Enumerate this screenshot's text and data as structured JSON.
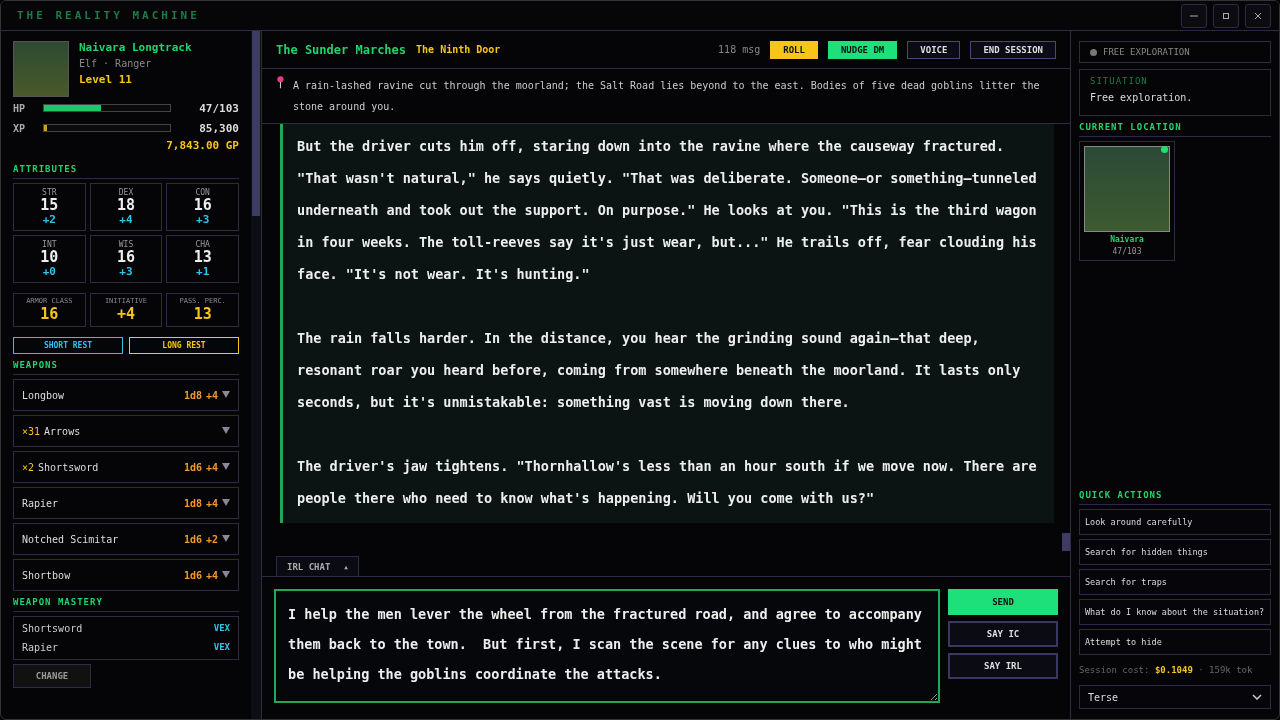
{
  "window": {
    "title": "THE REALITY MACHINE"
  },
  "character": {
    "name": "Naivara Longtrack",
    "race_class": "Elf · Ranger",
    "level": "Level 11",
    "hp": {
      "label": "HP",
      "level": 0.456,
      "reading": "47/103"
    },
    "xp": {
      "label": "XP",
      "level": 0.02,
      "reading": "85,300"
    },
    "gold": "7,843.00 GP"
  },
  "attributes_title": "ATTRIBUTES",
  "attributes": [
    {
      "abbr": "STR",
      "score": "15",
      "mod": "+2"
    },
    {
      "abbr": "DEX",
      "score": "18",
      "mod": "+4"
    },
    {
      "abbr": "CON",
      "score": "16",
      "mod": "+3"
    },
    {
      "abbr": "INT",
      "score": "10",
      "mod": "+0"
    },
    {
      "abbr": "WIS",
      "score": "16",
      "mod": "+3"
    },
    {
      "abbr": "CHA",
      "score": "13",
      "mod": "+1"
    }
  ],
  "derived": [
    {
      "label": "ARMOR CLASS",
      "value": "16"
    },
    {
      "label": "INITIATIVE",
      "value": "+4"
    },
    {
      "label": "PASS. PERC.",
      "value": "13"
    }
  ],
  "rest_buttons": [
    {
      "label": "SHORT REST",
      "kind": "short"
    },
    {
      "label": "LONG REST",
      "kind": "long"
    }
  ],
  "weapons_title": "WEAPONS",
  "weapons": [
    {
      "name": "Longbow",
      "damage": "1d8",
      "bonus": "+4"
    },
    {
      "qty": "×31",
      "name": "Arrows"
    },
    {
      "qty": "×2",
      "name": "Shortsword",
      "damage": "1d6",
      "bonus": "+4"
    },
    {
      "name": "Rapier",
      "damage": "1d8",
      "bonus": "+4"
    },
    {
      "name": "Notched Scimitar",
      "damage": "1d6",
      "bonus": "+2"
    },
    {
      "name": "Shortbow",
      "damage": "1d6",
      "bonus": "+4"
    }
  ],
  "mastery_title": "WEAPON MASTERY",
  "mastery": [
    {
      "name": "Shortsword",
      "property": "VEX"
    },
    {
      "name": "Rapier",
      "property": "VEX"
    }
  ],
  "change_button": "CHANGE",
  "header": {
    "campaign": "The Sunder Marches",
    "chapter": "The Ninth Door",
    "msg_count": "118 msg",
    "buttons": [
      {
        "label": "ROLL",
        "kind": "yellow"
      },
      {
        "label": "NUDGE DM",
        "kind": "green"
      },
      {
        "label": "VOICE",
        "kind": "outline"
      },
      {
        "label": "END SESSION",
        "kind": "outline"
      }
    ]
  },
  "location_text": "A rain-lashed ravine cut through the moorland; the Salt Road lies beyond to the east. Bodies of five dead goblins litter the stone around you.",
  "narrative": [
    "But the driver cuts him off, staring down into the ravine where the causeway fractured. \"That wasn't natural,\" he says quietly. \"That was deliberate. Someone—or something—tunneled underneath and took out the support. On purpose.\" He looks at you. \"This is the third wagon in four weeks. The toll-reeves say it's just wear, but...\" He trails off, fear clouding his face. \"It's not wear. It's hunting.\"",
    "The rain falls harder. In the distance, you hear the grinding sound again—that deep, resonant roar you heard before, coming from somewhere beneath the moorland. It lasts only seconds, but it's unmistakable: something vast is moving down there.",
    "The driver's jaw tightens. \"Thornhallow's less than an hour south if we move now. There are people there who need to know what's happening. Will you come with us?\""
  ],
  "chat_tab": {
    "label": "IRL CHAT",
    "caret": "▲"
  },
  "input": {
    "value": "I help the men lever the wheel from the fractured road, and agree to accompany them back to the town.  But first, I scan the scene for any clues to who might be helping the goblins coordinate the attacks."
  },
  "send_buttons": [
    {
      "label": "SEND",
      "kind": "primary"
    },
    {
      "label": "SAY IC",
      "kind": "outline"
    },
    {
      "label": "SAY IRL",
      "kind": "outline"
    }
  ],
  "mode": {
    "label": "FREE EXPLORATION"
  },
  "situation": {
    "title": "SITUATION",
    "text": "Free exploration."
  },
  "location_title": "CURRENT LOCATION",
  "party": [
    {
      "name": "Naivara",
      "hp": "47/103",
      "online": true
    }
  ],
  "quick_actions_title": "QUICK ACTIONS",
  "quick_actions": [
    "Look around carefully",
    "Search for hidden things",
    "Search for traps",
    "What do I know about the situation?",
    "Attempt to hide"
  ],
  "session_cost": {
    "label": "Session cost:",
    "amount": "$0.1049",
    "tokens": "· 159k tok"
  },
  "verbosity": {
    "value": "Terse"
  }
}
